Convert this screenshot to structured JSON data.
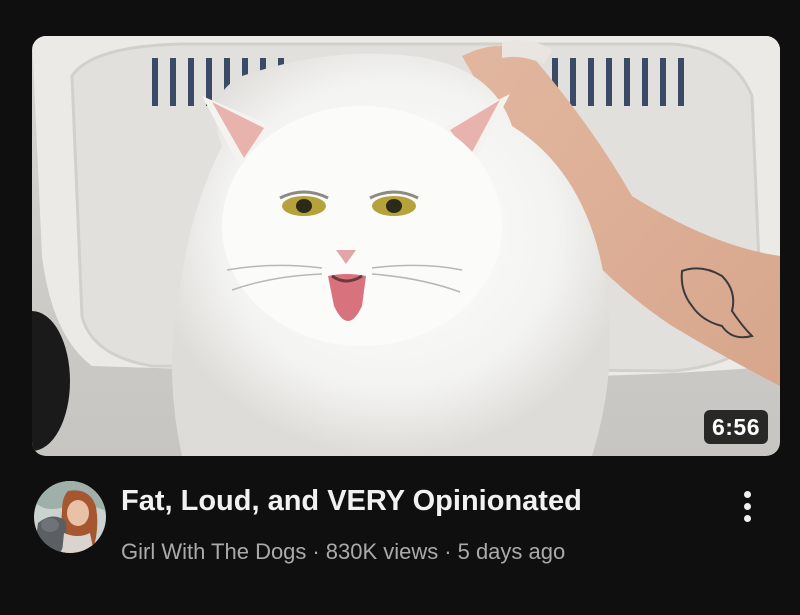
{
  "video": {
    "title": "Fat, Loud, and VERY Opinionated",
    "duration": "6:56",
    "channel": "Girl With The Dogs",
    "views": "830K views",
    "age": "5 days ago",
    "separator": "·"
  },
  "icons": {
    "more": "more-vert-icon"
  },
  "colors": {
    "background": "#0f0f0f",
    "title": "#f1f1f1",
    "meta": "#aaaaaa",
    "duration_badge": "#000000"
  }
}
